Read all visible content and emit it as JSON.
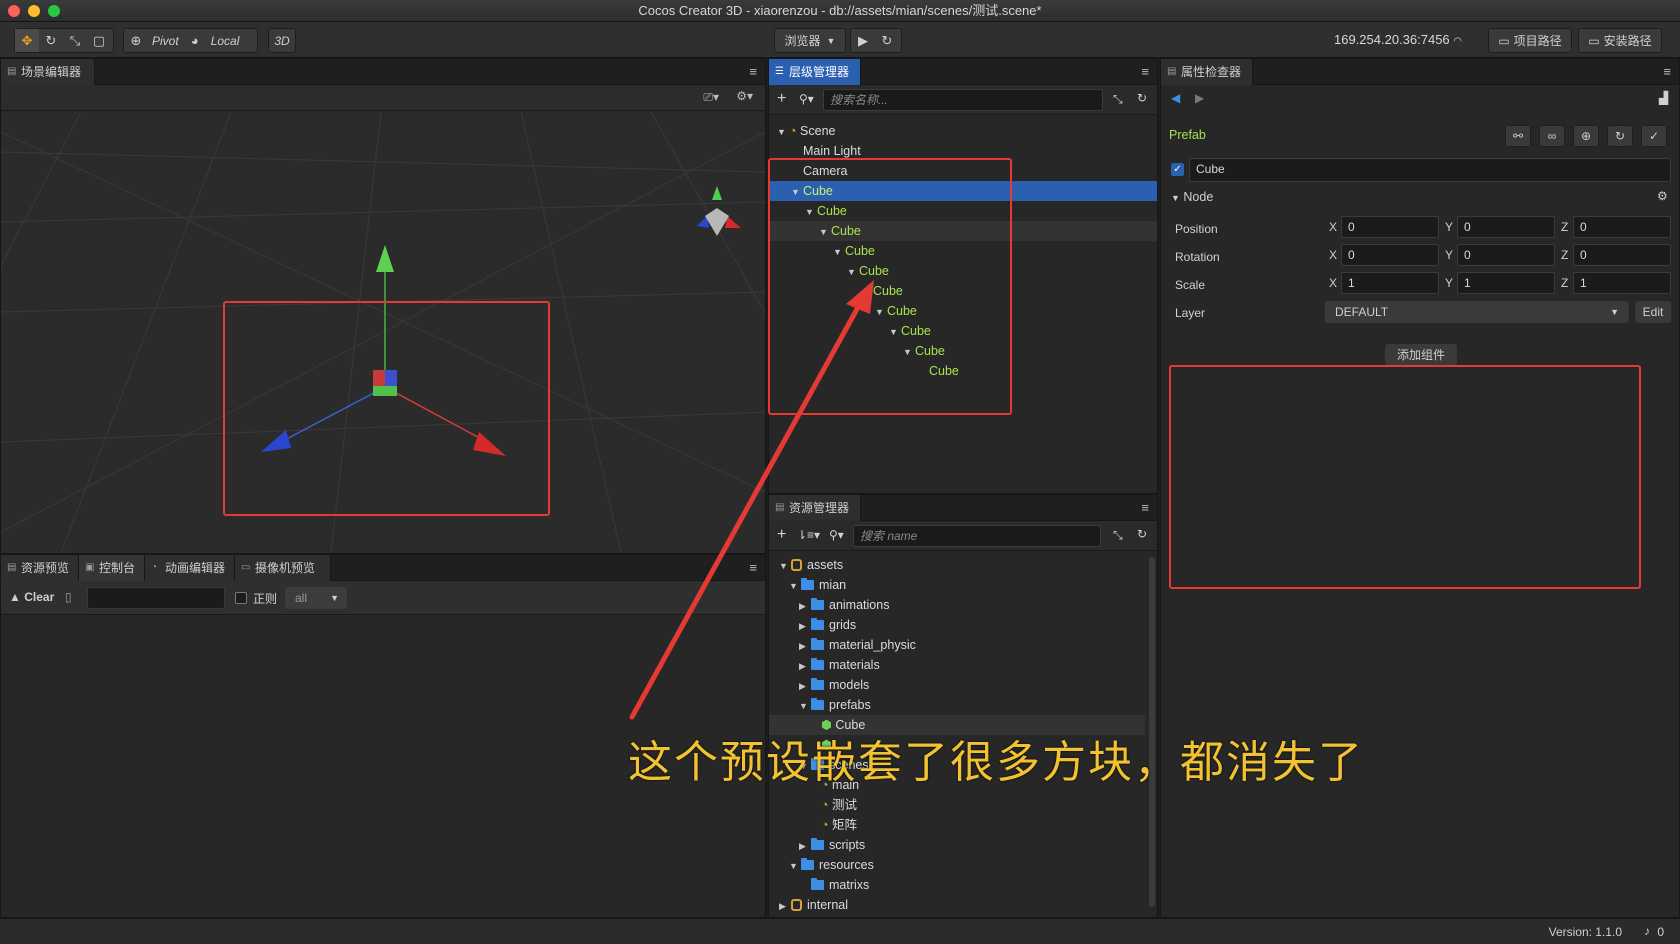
{
  "window": {
    "title": "Cocos Creator 3D - xiaorenzou - db://assets/mian/scenes/测试.scene*"
  },
  "toolbar": {
    "pivot": "Pivot",
    "local": "Local",
    "mode3d": "3D",
    "browser": "浏览器",
    "ip": "169.254.20.36:7456",
    "project_path": "项目路径",
    "install_path": "安装路径"
  },
  "scene_editor": {
    "tab": "场景编辑器"
  },
  "console": {
    "tabs": [
      "资源预览",
      "控制台",
      "动画编辑器",
      "摄像机预览"
    ],
    "clear": "Clear",
    "regex": "正则",
    "filter": "all"
  },
  "hierarchy": {
    "tab": "层级管理器",
    "search_placeholder": "搜索名称...",
    "nodes": [
      {
        "label": "Scene",
        "depth": 0,
        "type": "scene"
      },
      {
        "label": "Main Light",
        "depth": 1,
        "type": "node"
      },
      {
        "label": "Camera",
        "depth": 1,
        "type": "node"
      },
      {
        "label": "Cube",
        "depth": 1,
        "type": "prefab",
        "selected": true
      },
      {
        "label": "Cube",
        "depth": 2,
        "type": "prefab"
      },
      {
        "label": "Cube",
        "depth": 3,
        "type": "prefab"
      },
      {
        "label": "Cube",
        "depth": 4,
        "type": "prefab"
      },
      {
        "label": "Cube",
        "depth": 5,
        "type": "prefab"
      },
      {
        "label": "Cube",
        "depth": 6,
        "type": "prefab"
      },
      {
        "label": "Cube",
        "depth": 7,
        "type": "prefab"
      },
      {
        "label": "Cube",
        "depth": 8,
        "type": "prefab"
      },
      {
        "label": "Cube",
        "depth": 9,
        "type": "prefab"
      },
      {
        "label": "Cube",
        "depth": 10,
        "type": "prefab"
      }
    ]
  },
  "assets": {
    "tab": "资源管理器",
    "search_placeholder": "搜索 name",
    "items": [
      {
        "label": "assets",
        "depth": 0,
        "icon": "db",
        "expanded": true
      },
      {
        "label": "mian",
        "depth": 1,
        "icon": "folder",
        "expanded": true
      },
      {
        "label": "animations",
        "depth": 2,
        "icon": "folder",
        "expanded": false
      },
      {
        "label": "grids",
        "depth": 2,
        "icon": "folder",
        "expanded": false
      },
      {
        "label": "material_physic",
        "depth": 2,
        "icon": "folder",
        "expanded": false
      },
      {
        "label": "materials",
        "depth": 2,
        "icon": "folder",
        "expanded": false
      },
      {
        "label": "models",
        "depth": 2,
        "icon": "folder",
        "expanded": false
      },
      {
        "label": "prefabs",
        "depth": 2,
        "icon": "folder",
        "expanded": true
      },
      {
        "label": "Cube",
        "depth": 3,
        "icon": "prefab"
      },
      {
        "label": "",
        "depth": 3,
        "icon": "prefab"
      },
      {
        "label": "scenes",
        "depth": 2,
        "icon": "folder",
        "expanded": true
      },
      {
        "label": "main",
        "depth": 3,
        "icon": "scene"
      },
      {
        "label": "测试",
        "depth": 3,
        "icon": "scene"
      },
      {
        "label": "矩阵",
        "depth": 3,
        "icon": "scene"
      },
      {
        "label": "scripts",
        "depth": 2,
        "icon": "folder",
        "expanded": false
      },
      {
        "label": "resources",
        "depth": 1,
        "icon": "folder",
        "expanded": true
      },
      {
        "label": "matrixs",
        "depth": 2,
        "icon": "folder"
      },
      {
        "label": "internal",
        "depth": 0,
        "icon": "db",
        "expanded": false
      }
    ]
  },
  "inspector": {
    "tab": "属性检查器",
    "prefab_label": "Prefab",
    "node_name": "Cube",
    "section": "Node",
    "position": {
      "label": "Position",
      "x": "0",
      "y": "0",
      "z": "0"
    },
    "rotation": {
      "label": "Rotation",
      "x": "0",
      "y": "0",
      "z": "0"
    },
    "scale": {
      "label": "Scale",
      "x": "1",
      "y": "1",
      "z": "1"
    },
    "layer": {
      "label": "Layer",
      "value": "DEFAULT",
      "edit": "Edit"
    },
    "add_component": "添加组件",
    "axes": {
      "x": "X",
      "y": "Y",
      "z": "Z"
    }
  },
  "annotation": {
    "text": "这个预设嵌套了很多方块，都消失了",
    "color": "#e53a33"
  },
  "status": {
    "version": "Version: 1.1.0",
    "notifications": "0"
  },
  "colors": {
    "accent": "#2b5fb0",
    "prefab_green": "#a8e34f",
    "annotation_red": "#e53a33",
    "annotation_text": "#f2c230"
  }
}
